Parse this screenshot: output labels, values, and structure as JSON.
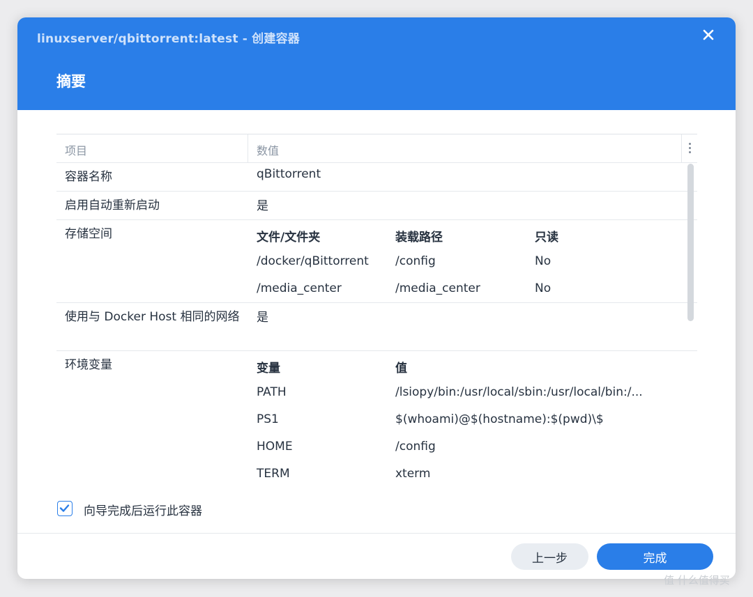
{
  "window": {
    "title": "linuxserver/qbittorrent:latest - 创建容器",
    "heading": "摘要"
  },
  "table": {
    "columns": {
      "item": "项目",
      "value": "数值"
    },
    "rows": {
      "container_name": {
        "label": "容器名称",
        "value": "qBittorrent"
      },
      "auto_restart": {
        "label": "启用自动重新启动",
        "value": "是"
      },
      "storage": {
        "label": "存储空间",
        "headers": {
          "folder": "文件/文件夹",
          "mount": "装载路径",
          "readonly": "只读"
        },
        "entries": [
          {
            "folder": "/docker/qBittorrent",
            "mount": "/config",
            "readonly": "No"
          },
          {
            "folder": "/media_center",
            "mount": "/media_center",
            "readonly": "No"
          }
        ]
      },
      "host_network": {
        "label": "使用与 Docker Host 相同的网络",
        "value": "是"
      },
      "env": {
        "label": "环境变量",
        "headers": {
          "var": "变量",
          "value": "值"
        },
        "entries": [
          {
            "var": "PATH",
            "value": "/lsiopy/bin:/usr/local/sbin:/usr/local/bin:/..."
          },
          {
            "var": "PS1",
            "value": "$(whoami)@$(hostname):$(pwd)\\$"
          },
          {
            "var": "HOME",
            "value": "/config"
          },
          {
            "var": "TERM",
            "value": "xterm"
          }
        ]
      }
    }
  },
  "checkbox": {
    "label": "向导完成后运行此容器",
    "checked": true
  },
  "buttons": {
    "back": "上一步",
    "finish": "完成"
  },
  "watermark": "值 什么值得买",
  "colors": {
    "accent": "#2a7ee8",
    "header_bg": "#2a7ee8"
  }
}
